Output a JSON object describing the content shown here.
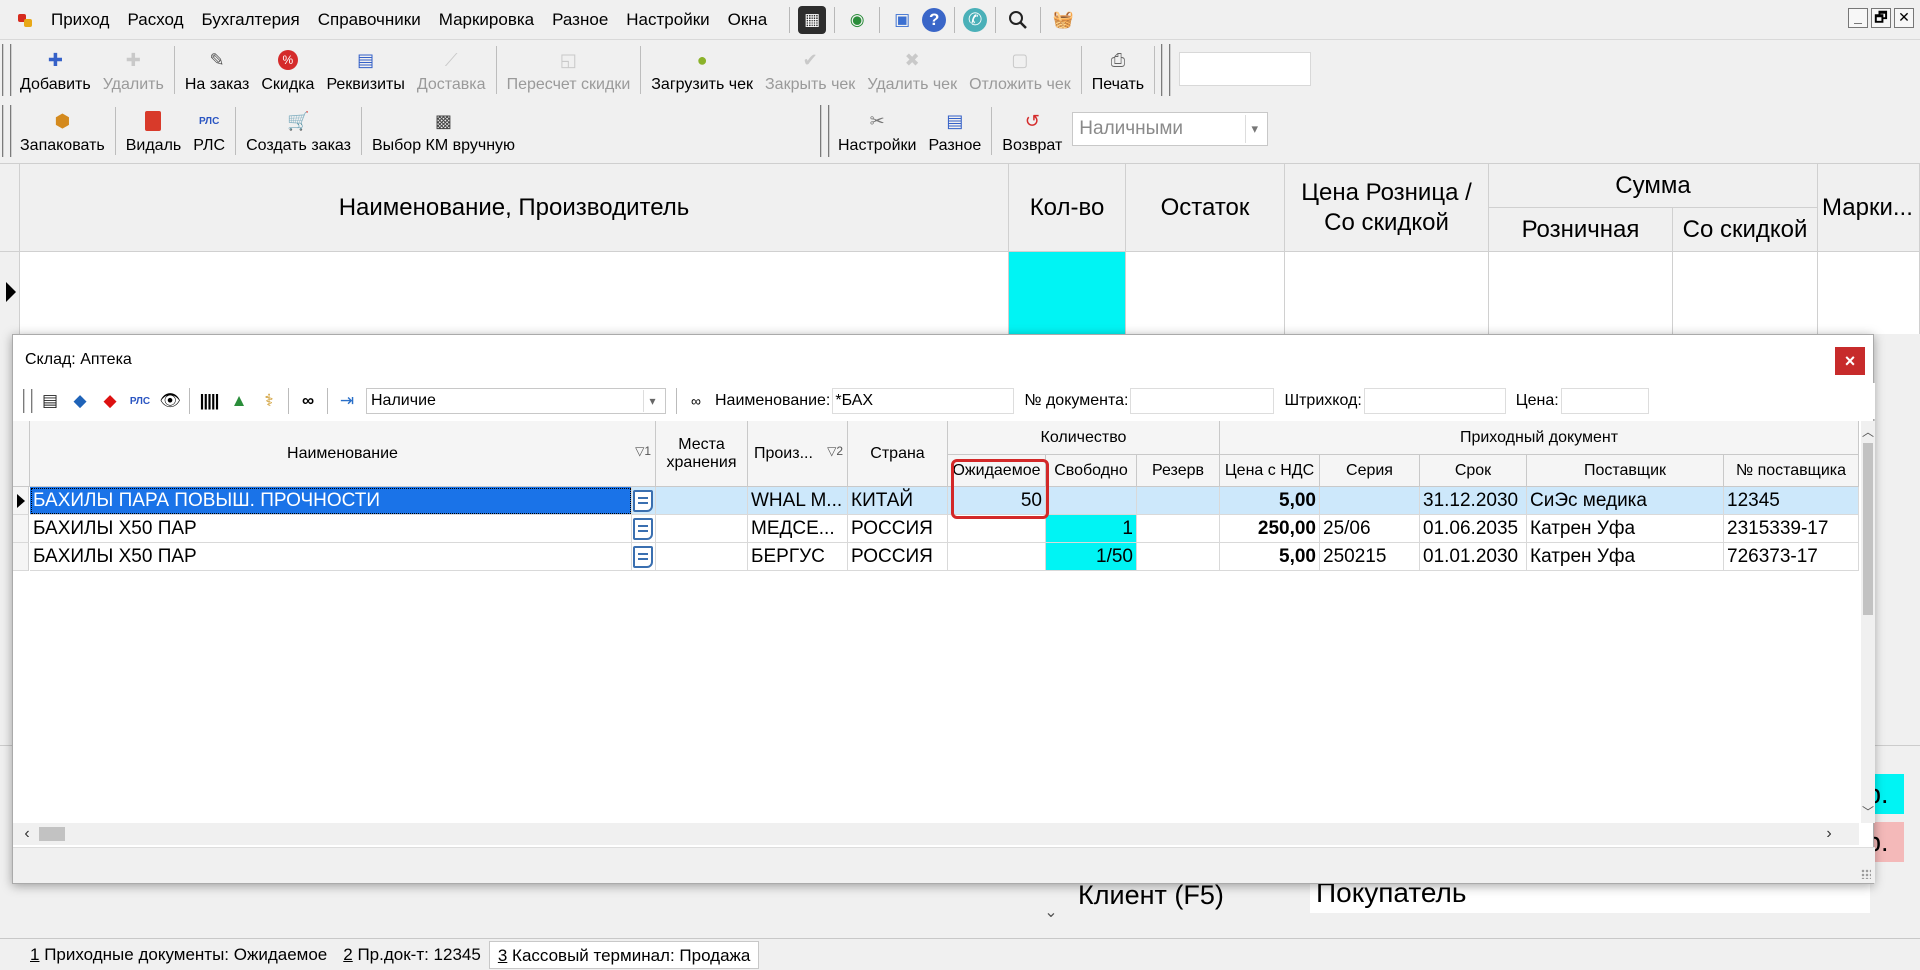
{
  "menu": {
    "items": [
      "Приход",
      "Расход",
      "Бухгалтерия",
      "Справочники",
      "Маркировка",
      "Разное",
      "Настройки",
      "Окна"
    ],
    "tool_icons": [
      "calendar-icon",
      "globe-money-icon",
      "box-icon",
      "help-icon",
      "phone-icon",
      "search-icon",
      "basket-icon"
    ],
    "window_controls": [
      "_",
      "🗗",
      "✕"
    ]
  },
  "toolbar1": {
    "buttons": [
      {
        "label": "Добавить",
        "icon": "add-icon",
        "enabled": true
      },
      {
        "label": "Удалить",
        "icon": "delete-icon",
        "enabled": false
      },
      {
        "label": "На заказ",
        "icon": "order-icon",
        "enabled": true
      },
      {
        "label": "Скидка",
        "icon": "discount-icon",
        "enabled": true
      },
      {
        "label": "Реквизиты",
        "icon": "details-icon",
        "enabled": true
      },
      {
        "label": "Доставка",
        "icon": "delivery-icon",
        "enabled": false
      },
      {
        "label": "Пересчет скидки",
        "icon": "recalc-icon",
        "enabled": false
      },
      {
        "label": "Загрузить чек",
        "icon": "load-receipt-icon",
        "enabled": true
      },
      {
        "label": "Закрыть чек",
        "icon": "check-icon",
        "enabled": false
      },
      {
        "label": "Удалить чек",
        "icon": "x-icon",
        "enabled": false
      },
      {
        "label": "Отложить чек",
        "icon": "postpone-icon",
        "enabled": false
      },
      {
        "label": "Печать",
        "icon": "print-icon",
        "enabled": true
      }
    ]
  },
  "toolbar2": {
    "left_buttons": [
      {
        "label": "Запаковать",
        "icon": "pack-icon"
      },
      {
        "label": "Видаль",
        "icon": "vidal-icon"
      },
      {
        "label": "РЛС",
        "icon": "rls-icon"
      },
      {
        "label": "Создать заказ",
        "icon": "create-order-icon"
      },
      {
        "label": "Выбор КМ вручную",
        "icon": "qr-code-icon"
      }
    ],
    "right_buttons": [
      {
        "label": "Настройки",
        "icon": "tools-icon"
      },
      {
        "label": "Разное",
        "icon": "misc-icon"
      },
      {
        "label": "Возврат",
        "icon": "return-icon"
      }
    ],
    "payment_select": "Наличными"
  },
  "main_grid": {
    "headers": {
      "name": "Наименование, Производитель",
      "qty": "Кол-во",
      "stock": "Остаток",
      "price": "Цена Розница / Со скидкой",
      "sum": "Сумма",
      "sum_retail": "Розничная",
      "sum_discount": "Со скидкой",
      "marking": "Марки..."
    }
  },
  "dialog": {
    "title": "Склад: Аптека",
    "close": "×",
    "toolbar": {
      "availability_select": "Наличие",
      "name_filter_label": "Наименование:",
      "name_filter_value": "*БАХ",
      "doc_no_label": "№ документа:",
      "barcode_label": "Штрихкод:",
      "price_label": "Цена:"
    },
    "headers": {
      "name": "Наименование",
      "name_sort": "▽1",
      "storage": "Места хранения",
      "producer": "Произ...",
      "producer_sort": "▽2",
      "country": "Страна",
      "quantity": "Количество",
      "expected": "Ожидаемое",
      "free": "Свободно",
      "reserve": "Резерв",
      "incoming_doc": "Приходный документ",
      "price_vat": "Цена с НДС",
      "series": "Серия",
      "expiry": "Срок",
      "supplier": "Поставщик",
      "supplier_no": "№ поставщика"
    },
    "rows": [
      {
        "name": "БАХИЛЫ ПАРА ПОВЫШ. ПРОЧНОСТИ",
        "storage": "",
        "producer": "WHAL M...",
        "country": "КИТАЙ",
        "expected": "50",
        "free": "",
        "reserve": "",
        "price": "5,00",
        "series": "",
        "expiry": "31.12.2030",
        "supplier": "СиЭс медика",
        "supplier_no": "12345"
      },
      {
        "name": "БАХИЛЫ Х50 ПАР",
        "storage": "",
        "producer": "МЕДСЕ...",
        "country": "РОССИЯ",
        "expected": "",
        "free": "1",
        "reserve": "",
        "price": "250,00",
        "series": "25/06",
        "expiry": "01.06.2035",
        "supplier": "Катрен Уфа",
        "supplier_no": "2315339-17"
      },
      {
        "name": "БАХИЛЫ Х50 ПАР",
        "storage": "",
        "producer": "БЕРГУС",
        "country": "РОССИЯ",
        "expected": "",
        "free": "1/50",
        "reserve": "",
        "price": "5,00",
        "series": "250215",
        "expiry": "01.01.2030",
        "supplier": "Катрен Уфа",
        "supplier_no": "726373-17"
      }
    ]
  },
  "bottom": {
    "client_label": "Клиент (F5)",
    "client_value": "Покупатель",
    "cyan_fragment": "р.",
    "pink_fragment": "р."
  },
  "statusbar": {
    "items": [
      {
        "num": "1",
        "text": " Приходные документы: Ожидаемое"
      },
      {
        "num": "2",
        "text": " Пр.док-т: 12345"
      },
      {
        "num": "3",
        "text": " Кассовый терминал: Продажа"
      }
    ]
  },
  "colors": {
    "cyan": "#00f4f4",
    "selection": "#1a73e8",
    "highlight": "#d32828"
  }
}
